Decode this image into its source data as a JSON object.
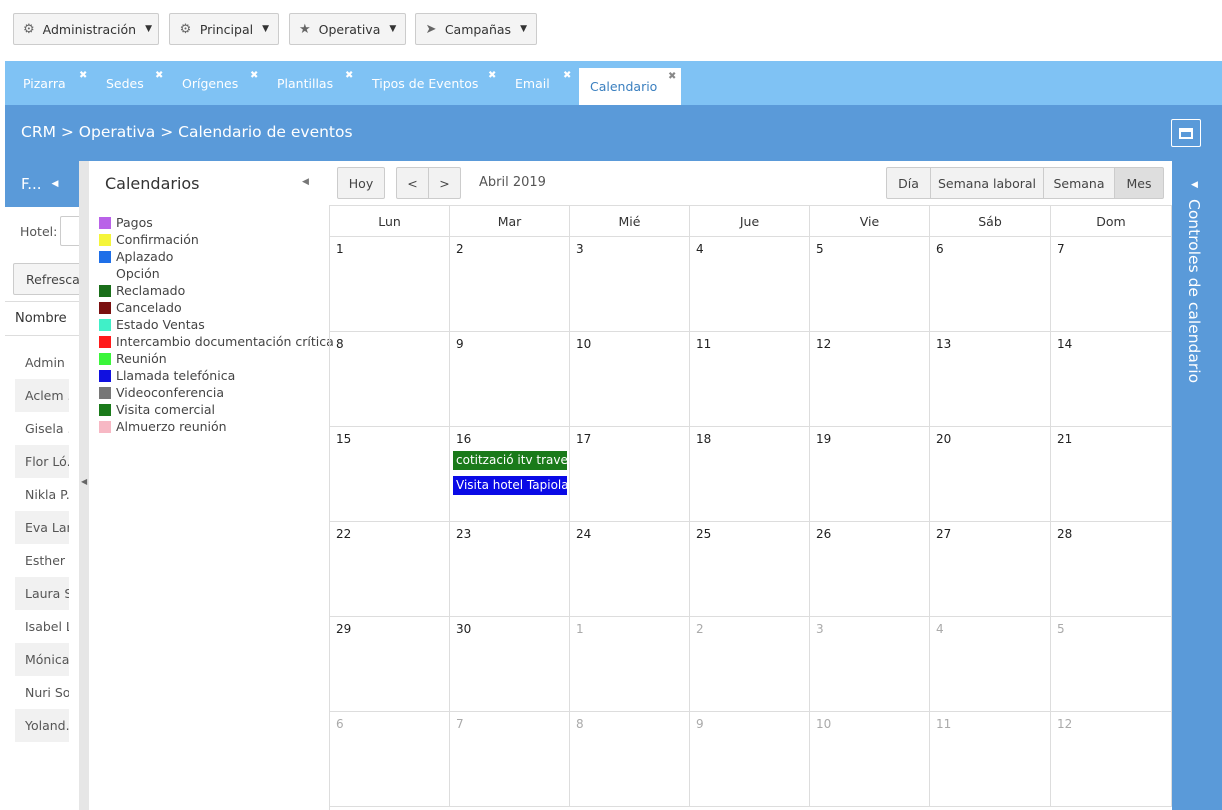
{
  "toolbar": {
    "items": [
      {
        "label": "Administración",
        "icon": "gear-icon"
      },
      {
        "label": "Principal",
        "icon": "circle-cog-icon"
      },
      {
        "label": "Operativa",
        "icon": "star-icon"
      },
      {
        "label": "Campañas",
        "icon": "paper-plane-icon"
      }
    ]
  },
  "tabs": [
    {
      "label": "Pizarra"
    },
    {
      "label": "Sedes"
    },
    {
      "label": "Orígenes"
    },
    {
      "label": "Plantillas"
    },
    {
      "label": "Tipos de Eventos"
    },
    {
      "label": "Email"
    },
    {
      "label": "Calendario",
      "active": true
    }
  ],
  "header": {
    "breadcrumb": "CRM > Operativa > Calendario de eventos"
  },
  "left_panel": {
    "title": "F...",
    "hotel_label": "Hotel:",
    "refresh_label": "Refrescar",
    "column_header": "Nombre",
    "rows": [
      "Admin ..",
      "Aclem ..",
      "Gisela ..",
      "Flor Ló.",
      "Nikla P.",
      "Eva Lar.",
      "Esther",
      "Laura S",
      "Isabel L",
      "Mónica.",
      "Nuri So",
      "Yoland."
    ]
  },
  "calendars_panel": {
    "title": "Calendarios",
    "items": [
      {
        "label": "Pagos",
        "color": "#b962e8"
      },
      {
        "label": "Confirmación",
        "color": "#f5f53a"
      },
      {
        "label": "Aplazado",
        "color": "#1e6fe8"
      },
      {
        "label": "Opción",
        "color": "#ffffff"
      },
      {
        "label": "Reclamado",
        "color": "#1a6e1a"
      },
      {
        "label": "Cancelado",
        "color": "#7a1010"
      },
      {
        "label": "Estado Ventas",
        "color": "#40f0c8"
      },
      {
        "label": "Intercambio documentación crítica",
        "color": "#ff1a1a"
      },
      {
        "label": "Reunión",
        "color": "#3af53a"
      },
      {
        "label": "Llamada telefónica",
        "color": "#1010e0"
      },
      {
        "label": "Videoconferencia",
        "color": "#777777"
      },
      {
        "label": "Visita comercial",
        "color": "#1a7a1a"
      },
      {
        "label": "Almuerzo reunión",
        "color": "#f7b8c4"
      }
    ]
  },
  "calendar": {
    "today_label": "Hoy",
    "prev_label": "<",
    "next_label": ">",
    "title": "Abril 2019",
    "views": [
      {
        "label": "Día"
      },
      {
        "label": "Semana laboral"
      },
      {
        "label": "Semana"
      },
      {
        "label": "Mes",
        "active": true
      }
    ],
    "weekdays": [
      "Lun",
      "Mar",
      "Mié",
      "Jue",
      "Vie",
      "Sáb",
      "Dom"
    ],
    "weeks": [
      [
        {
          "d": "1"
        },
        {
          "d": "2"
        },
        {
          "d": "3"
        },
        {
          "d": "4"
        },
        {
          "d": "5"
        },
        {
          "d": "6"
        },
        {
          "d": "7"
        }
      ],
      [
        {
          "d": "8"
        },
        {
          "d": "9"
        },
        {
          "d": "10"
        },
        {
          "d": "11"
        },
        {
          "d": "12"
        },
        {
          "d": "13"
        },
        {
          "d": "14"
        }
      ],
      [
        {
          "d": "15"
        },
        {
          "d": "16"
        },
        {
          "d": "17"
        },
        {
          "d": "18"
        },
        {
          "d": "19"
        },
        {
          "d": "20"
        },
        {
          "d": "21"
        }
      ],
      [
        {
          "d": "22"
        },
        {
          "d": "23"
        },
        {
          "d": "24"
        },
        {
          "d": "25"
        },
        {
          "d": "26"
        },
        {
          "d": "27"
        },
        {
          "d": "28"
        }
      ],
      [
        {
          "d": "29"
        },
        {
          "d": "30"
        },
        {
          "d": "1",
          "other": true
        },
        {
          "d": "2",
          "other": true
        },
        {
          "d": "3",
          "other": true
        },
        {
          "d": "4",
          "other": true
        },
        {
          "d": "5",
          "other": true
        }
      ],
      [
        {
          "d": "6",
          "other": true
        },
        {
          "d": "7",
          "other": true
        },
        {
          "d": "8",
          "other": true
        },
        {
          "d": "9",
          "other": true
        },
        {
          "d": "10",
          "other": true
        },
        {
          "d": "11",
          "other": true
        },
        {
          "d": "12",
          "other": true
        }
      ]
    ],
    "events": [
      {
        "title": "cotització itv travel...",
        "week": 2,
        "day": 1,
        "slot": 0,
        "color": "#1a7a1a"
      },
      {
        "title": "Visita hotel Tapiolas",
        "week": 2,
        "day": 1,
        "slot": 1,
        "color": "#0a0ae6"
      }
    ]
  },
  "right_bar": {
    "label": "Controles de calendario"
  }
}
